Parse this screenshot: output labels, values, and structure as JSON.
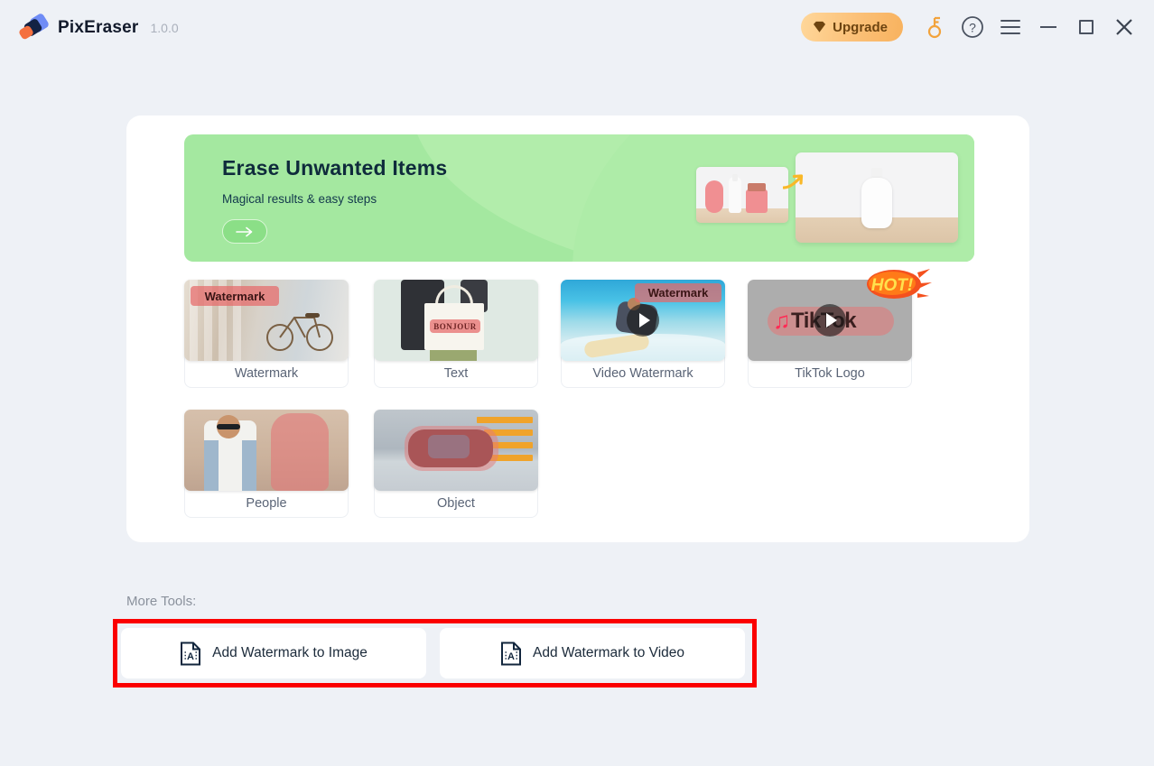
{
  "app": {
    "name": "PixEraser",
    "version": "1.0.0",
    "logo_icon": "eraser-icon"
  },
  "titlebar": {
    "upgrade_label": "Upgrade",
    "upgrade_icon": "gem-icon",
    "key_icon": "key-icon",
    "help_icon": "question-mark-icon",
    "menu_icon": "hamburger-menu-icon",
    "minimize_icon": "minimize-icon",
    "maximize_icon": "maximize-icon",
    "close_icon": "close-icon",
    "accent_upgrade": "#f8b25e"
  },
  "banner": {
    "title": "Erase Unwanted Items",
    "subtitle": "Magical results & easy steps",
    "cta_icon": "arrow-right-icon",
    "background": "#a4e8a0",
    "title_color": "#0f2b3c"
  },
  "tools": [
    {
      "label": "Watermark",
      "overlay_text": "Watermark",
      "badge": "",
      "has_play": false,
      "thumb": "bicycle-photo"
    },
    {
      "label": "Text",
      "overlay_text": "BONJOUR",
      "badge": "",
      "has_play": false,
      "thumb": "tote-bag-photo"
    },
    {
      "label": "Video Watermark",
      "overlay_text": "Watermark",
      "badge": "",
      "has_play": true,
      "thumb": "surfer-video"
    },
    {
      "label": "TikTok Logo",
      "overlay_text": "TikTok",
      "badge": "HOT!",
      "has_play": true,
      "thumb": "tiktok-logo-video"
    },
    {
      "label": "People",
      "overlay_text": "",
      "badge": "",
      "has_play": false,
      "thumb": "people-photo"
    },
    {
      "label": "Object",
      "overlay_text": "",
      "badge": "",
      "has_play": false,
      "thumb": "car-photo"
    }
  ],
  "more_tools": {
    "heading": "More Tools:",
    "highlight_color": "#fb0000",
    "buttons": [
      {
        "label": "Add Watermark to Image",
        "icon": "watermark-document-icon"
      },
      {
        "label": "Add Watermark to Video",
        "icon": "watermark-document-icon"
      }
    ]
  }
}
